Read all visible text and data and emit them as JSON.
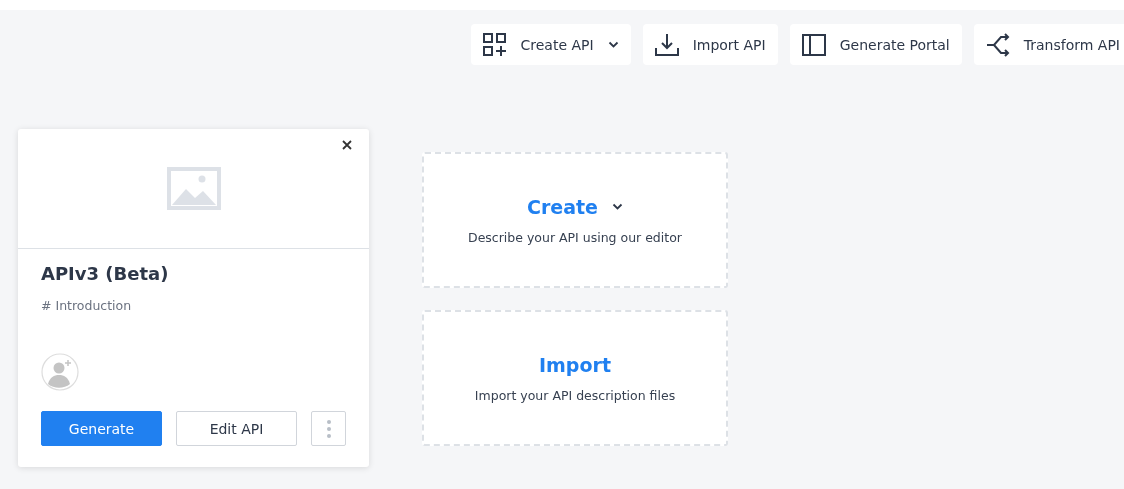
{
  "toolbar": [
    {
      "kind": "create",
      "label": "Create API",
      "dropdown": true
    },
    {
      "kind": "import",
      "label": "Import API",
      "dropdown": false
    },
    {
      "kind": "portal",
      "label": "Generate Portal",
      "dropdown": false
    },
    {
      "kind": "transform",
      "label": "Transform API",
      "dropdown": false
    }
  ],
  "api_card": {
    "title": "APIv3 (Beta)",
    "subtitle": "# Introduction",
    "buttons": [
      {
        "kind": "primary",
        "label": "Generate"
      },
      {
        "kind": "secondary",
        "label": "Edit API"
      }
    ]
  },
  "actions": [
    {
      "title": "Create",
      "description": "Describe your API using our editor",
      "dropdown": true
    },
    {
      "title": "Import",
      "description": "Import your API description files",
      "dropdown": false
    }
  ]
}
